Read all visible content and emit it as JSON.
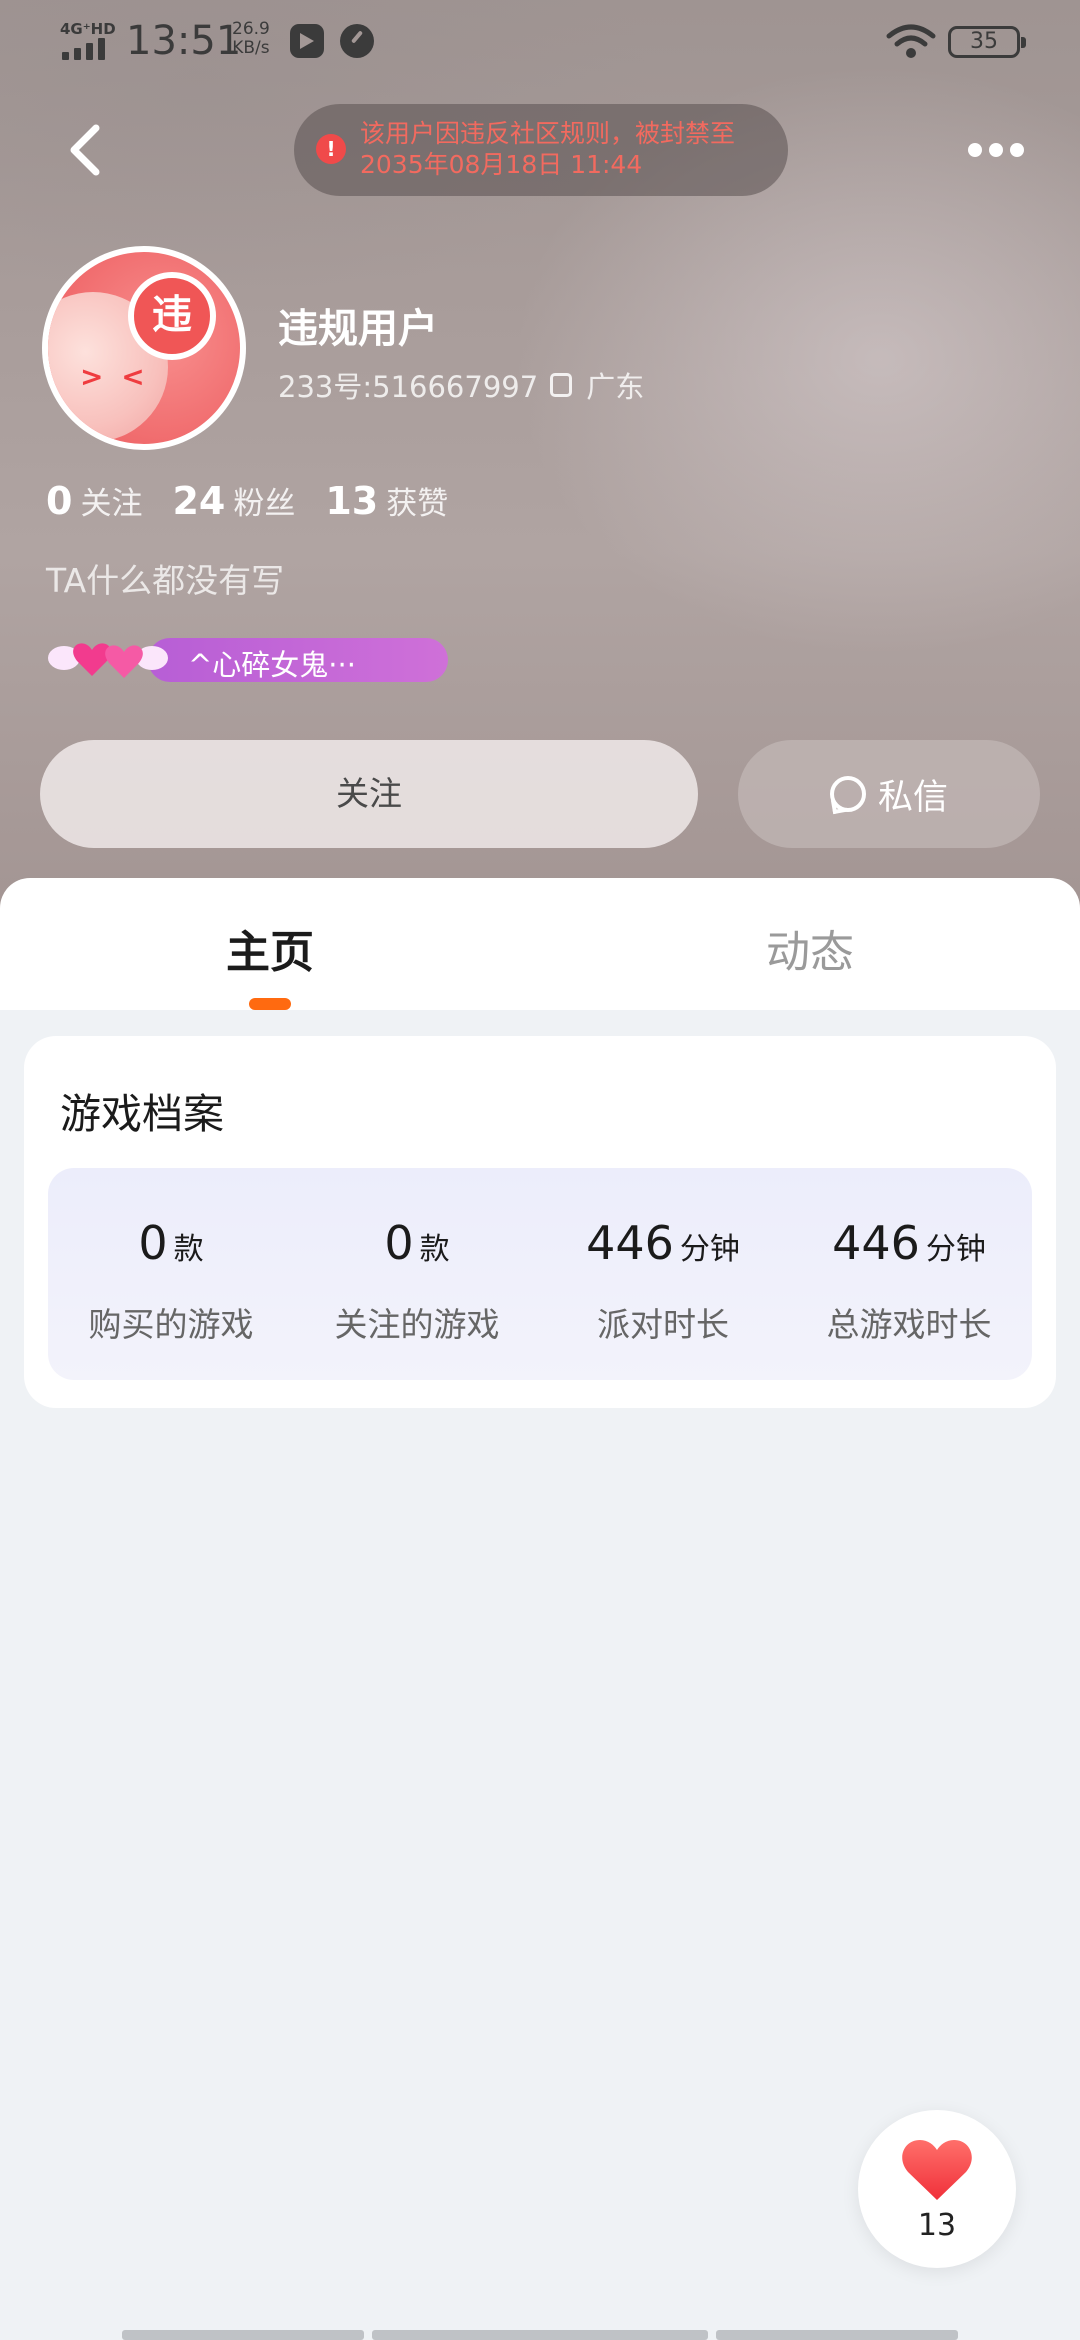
{
  "status_bar": {
    "network": "4G⁺HD",
    "time": "13:51",
    "speed_value": "26.9",
    "speed_unit": "KB/s",
    "battery": "35"
  },
  "ban_notice": {
    "line1": "该用户因违反社区规则，被封禁至",
    "line2": "2035年08月18日 11:44"
  },
  "profile": {
    "avatar_badge": "违",
    "username": "违规用户",
    "user_id": "233号:516667997",
    "location": "广东",
    "stats": [
      {
        "value": "0",
        "label": "关注"
      },
      {
        "value": "24",
        "label": "粉丝"
      },
      {
        "value": "13",
        "label": "获赞"
      }
    ],
    "bio": "TA什么都没有写",
    "title_badge": "^心碎女鬼···"
  },
  "actions": {
    "follow_label": "关注",
    "message_label": "私信"
  },
  "tabs": [
    {
      "label": "主页",
      "active": true
    },
    {
      "label": "动态",
      "active": false
    }
  ],
  "game_profile": {
    "title": "游戏档案",
    "metrics": [
      {
        "value": "0",
        "unit": "款",
        "label": "购买的游戏"
      },
      {
        "value": "0",
        "unit": "款",
        "label": "关注的游戏"
      },
      {
        "value": "446",
        "unit": "分钟",
        "label": "派对时长"
      },
      {
        "value": "446",
        "unit": "分钟",
        "label": "总游戏时长"
      }
    ]
  },
  "like_fab": {
    "count": "13"
  },
  "colors": {
    "accent": "#ff6a10",
    "ban_text": "#f26a5f",
    "ban_icon": "#f04a4a",
    "badge": "#f05656",
    "title_pill": "#c068d8"
  }
}
